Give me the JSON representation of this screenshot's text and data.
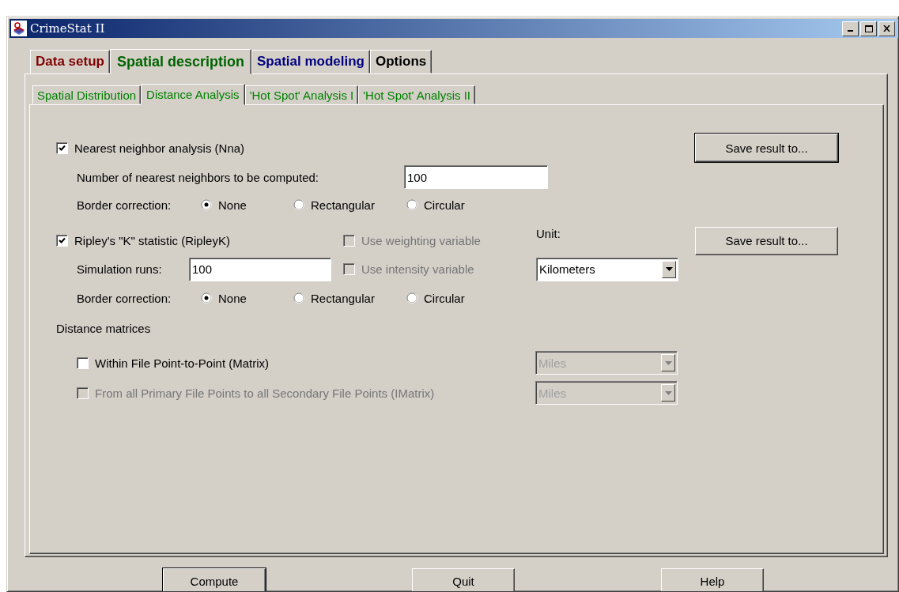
{
  "window": {
    "title": "CrimeStat II"
  },
  "tabs": [
    {
      "label": "Data setup",
      "selected": false,
      "color": "#800000"
    },
    {
      "label": "Spatial description",
      "selected": true,
      "color": "#006400"
    },
    {
      "label": "Spatial modeling",
      "selected": false,
      "color": "#000080"
    },
    {
      "label": "Options",
      "selected": false,
      "color": "#000000"
    }
  ],
  "subtabs": [
    {
      "label": "Spatial Distribution",
      "selected": false
    },
    {
      "label": "Distance Analysis",
      "selected": true
    },
    {
      "label": "'Hot Spot' Analysis I",
      "selected": false
    },
    {
      "label": "'Hot Spot' Analysis II",
      "selected": false
    }
  ],
  "nna": {
    "label": "Nearest neighbor analysis (Nna)",
    "checked": true,
    "save_button": "Save result to...",
    "save_default": true,
    "neighbors_label": "Number of nearest neighbors to be computed:",
    "neighbors_value": "100",
    "border_label": "Border correction:",
    "border_options": [
      {
        "label": "None",
        "selected": true
      },
      {
        "label": "Rectangular",
        "selected": false
      },
      {
        "label": "Circular",
        "selected": false
      }
    ]
  },
  "ripley": {
    "label": "Ripley's \"K\" statistic (RipleyK)",
    "checked": true,
    "weighting": {
      "label": "Use weighting variable",
      "checked": false,
      "disabled": true
    },
    "intensity": {
      "label": "Use intensity variable",
      "checked": false,
      "disabled": true
    },
    "unit_label": "Unit:",
    "unit_value": "Kilometers",
    "save_button": "Save result to...",
    "save_default": false,
    "runs_label": "Simulation runs:",
    "runs_value": "100",
    "border_label": "Border correction:",
    "border_options": [
      {
        "label": "None",
        "selected": true
      },
      {
        "label": "Rectangular",
        "selected": false
      },
      {
        "label": "Circular",
        "selected": false
      }
    ]
  },
  "distance_matrices": {
    "heading": "Distance matrices",
    "items": [
      {
        "label": "Within File Point-to-Point (Matrix)",
        "checked": false,
        "disabled": false,
        "unit": "Miles",
        "unit_disabled": true
      },
      {
        "label": "From all Primary File Points to all Secondary File Points (IMatrix)",
        "checked": false,
        "disabled": true,
        "unit": "Miles",
        "unit_disabled": true
      }
    ]
  },
  "buttons": [
    {
      "label": "Compute",
      "default": true
    },
    {
      "label": "Quit",
      "default": false
    },
    {
      "label": "Help",
      "default": false
    }
  ]
}
